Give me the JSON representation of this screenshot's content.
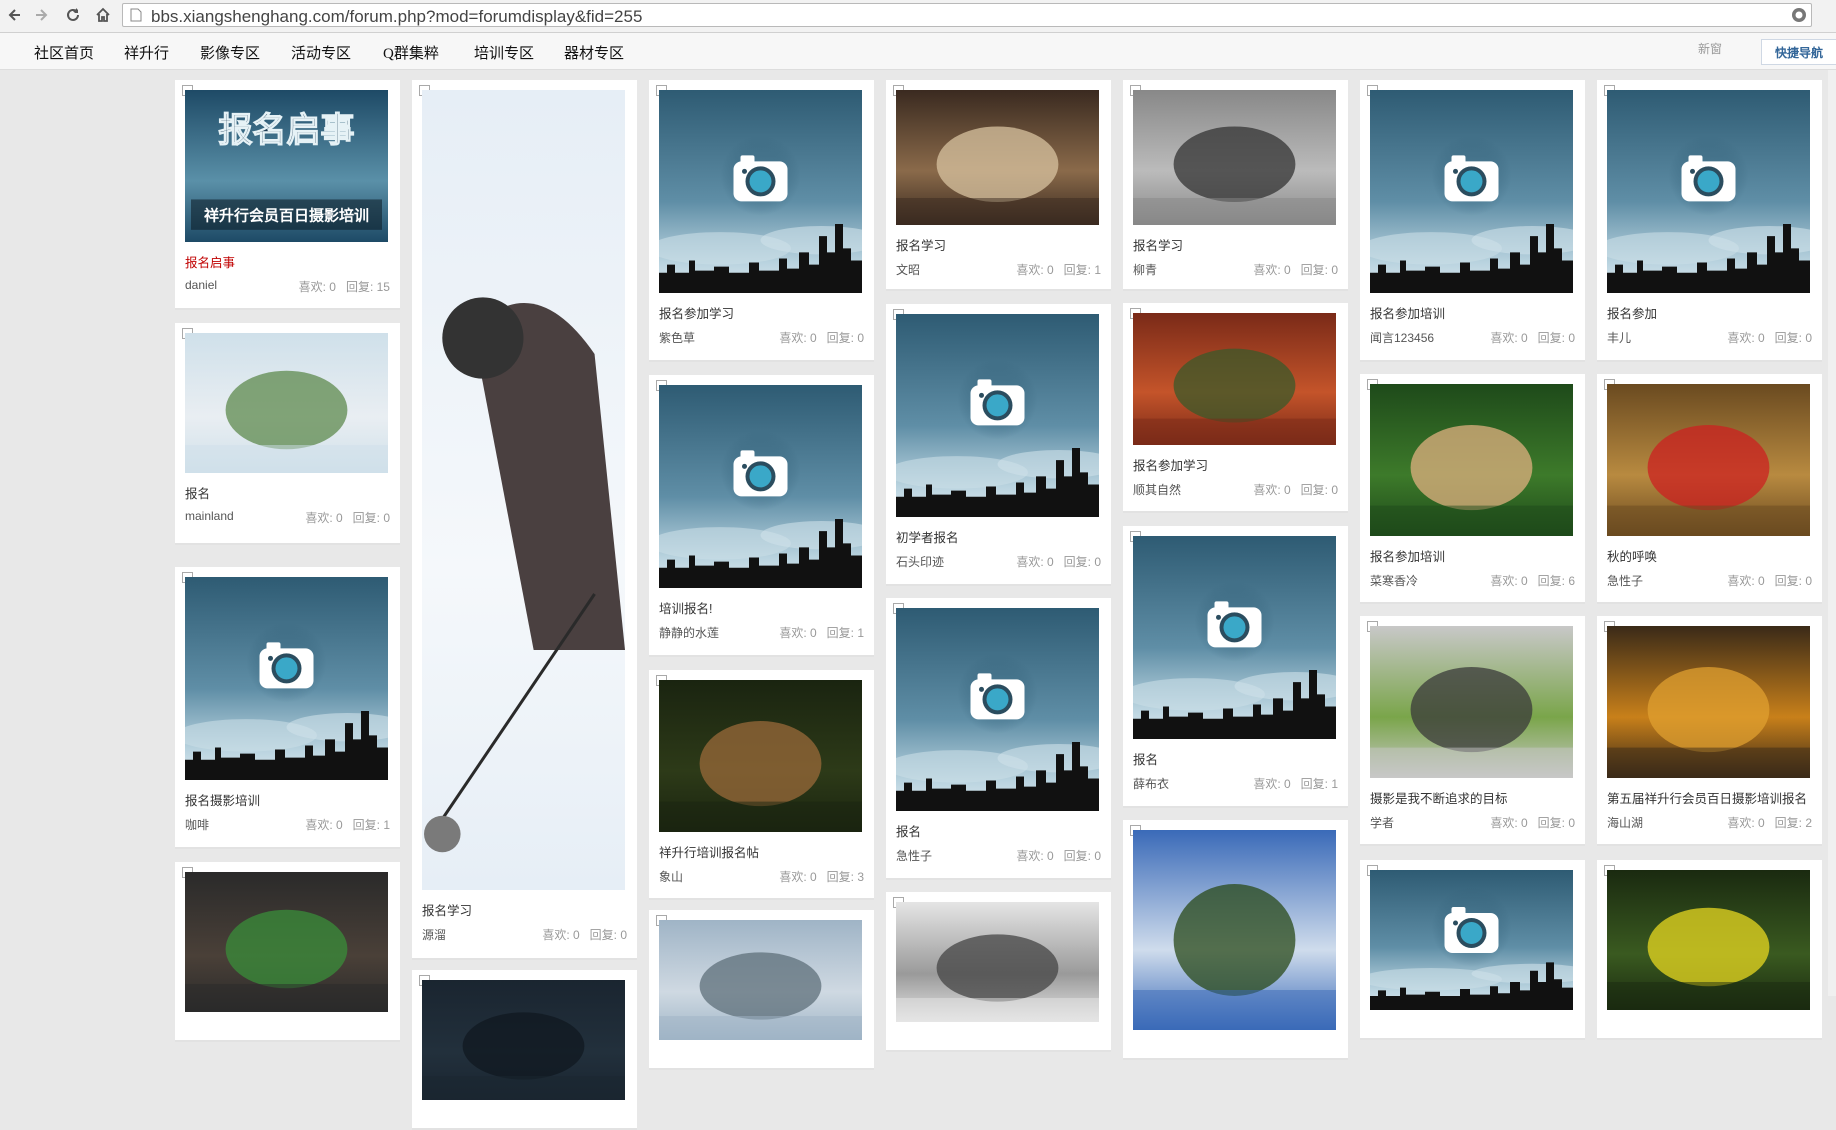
{
  "browser": {
    "url": "bbs.xiangshenghang.com/forum.php?mod=forumdisplay&fid=255"
  },
  "nav": {
    "items": [
      "社区首页",
      "祥升行",
      "影像专区",
      "活动专区",
      "Q群集粹",
      "培训专区",
      "器材专区"
    ],
    "new_label": "新窗",
    "quicknav_label": "快捷导航"
  },
  "labels": {
    "likes_prefix": "喜欢: ",
    "replies_prefix": "回复: "
  },
  "cards": [
    {
      "id": "c0",
      "title": "报名启事",
      "author": "daniel",
      "likes": "0",
      "replies": "15",
      "title_red": true,
      "image": "banner-signup-photo"
    },
    {
      "id": "c1",
      "title": "报名",
      "author": "mainland",
      "likes": "0",
      "replies": "0",
      "image": "village-lake-photo"
    },
    {
      "id": "c2",
      "title": "报名摄影培训",
      "author": "咖啡",
      "likes": "0",
      "replies": "1",
      "image": "default-camera"
    },
    {
      "id": "c3",
      "title": "",
      "author": "",
      "image": "child-photo"
    },
    {
      "id": "c4",
      "title": "报名学习",
      "author": "源溜",
      "likes": "0",
      "replies": "0",
      "image": "ice-fishing-photo"
    },
    {
      "id": "c5",
      "title": "",
      "author": "",
      "image": "dark-photo"
    },
    {
      "id": "c6",
      "title": "报名参加学习",
      "author": "紫色草",
      "likes": "0",
      "replies": "0",
      "image": "default-camera"
    },
    {
      "id": "c7",
      "title": "培训报名!",
      "author": "静静的水莲",
      "likes": "0",
      "replies": "1",
      "image": "default-camera"
    },
    {
      "id": "c8",
      "title": "祥升行培训报名帖",
      "author": "象山",
      "likes": "0",
      "replies": "3",
      "image": "lotus-leaf-photo"
    },
    {
      "id": "c9",
      "title": "",
      "author": "",
      "image": "lake-boats-photo"
    },
    {
      "id": "c10",
      "title": "报名学习",
      "author": "文昭",
      "likes": "0",
      "replies": "1",
      "image": "woman-phone-photo"
    },
    {
      "id": "c11",
      "title": "初学者报名",
      "author": "石头印迹",
      "likes": "0",
      "replies": "0",
      "image": "default-camera"
    },
    {
      "id": "c12",
      "title": "报名",
      "author": "急性子",
      "likes": "0",
      "replies": "0",
      "image": "default-camera"
    },
    {
      "id": "c13",
      "title": "",
      "author": "",
      "image": "misty-mountain-photo"
    },
    {
      "id": "c14",
      "title": "报名学习",
      "author": "柳青",
      "likes": "0",
      "replies": "0",
      "image": "bw-man-photo"
    },
    {
      "id": "c15",
      "title": "报名参加学习",
      "author": "顺其自然",
      "likes": "0",
      "replies": "0",
      "image": "autumn-leaves-photo"
    },
    {
      "id": "c16",
      "title": "报名",
      "author": "薛布衣",
      "likes": "0",
      "replies": "1",
      "image": "default-camera"
    },
    {
      "id": "c17",
      "title": "",
      "author": "",
      "image": "tulips-photo"
    },
    {
      "id": "c18",
      "title": "报名参加培训",
      "author": "闻言123456",
      "likes": "0",
      "replies": "0",
      "image": "default-camera"
    },
    {
      "id": "c19",
      "title": "报名参加培训",
      "author": "菜寒香冷",
      "likes": "0",
      "replies": "6",
      "image": "pomegranate-photo"
    },
    {
      "id": "c20",
      "title": "摄影是我不断追求的目标",
      "author": "学者",
      "likes": "0",
      "replies": "0",
      "image": "garden-aerial-photo"
    },
    {
      "id": "c21",
      "title": "",
      "author": "",
      "image": "default-camera"
    },
    {
      "id": "c22",
      "title": "报名参加",
      "author": "丰儿",
      "likes": "0",
      "replies": "0",
      "image": "default-camera"
    },
    {
      "id": "c23",
      "title": "秋的呼唤",
      "author": "急性子",
      "likes": "0",
      "replies": "0",
      "image": "woman-reeds-photo"
    },
    {
      "id": "c24",
      "title": "第五届祥升行会员百日摄影培训报名",
      "author": "海山湖",
      "likes": "0",
      "replies": "2",
      "image": "swan-boats-photo"
    },
    {
      "id": "c25",
      "title": "",
      "author": "",
      "image": "yellow-flowers-photo"
    }
  ],
  "banner_text": {
    "line1": "报名启事",
    "line2": "祥升行会员百日摄影培训"
  }
}
